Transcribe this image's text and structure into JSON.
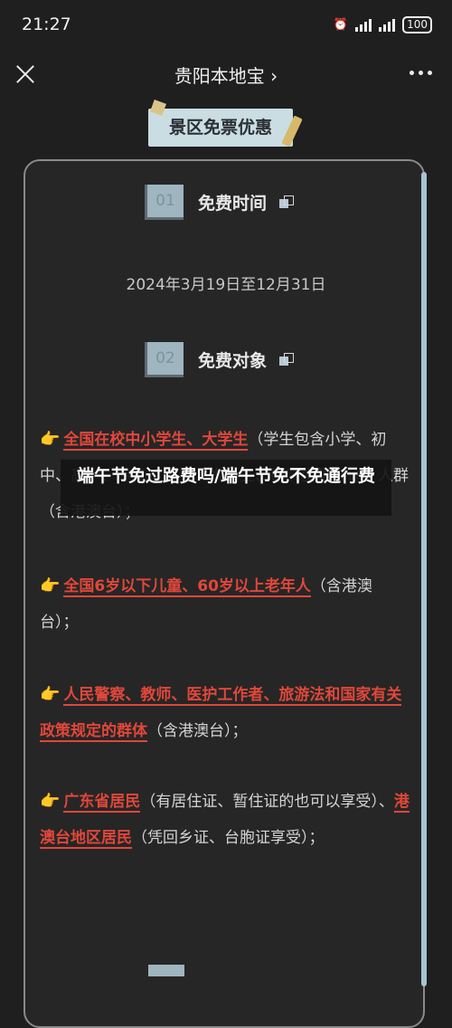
{
  "status": {
    "time": "21:27",
    "battery": "100"
  },
  "nav": {
    "title": "贵阳本地宝 ›"
  },
  "banner": {
    "label": "景区免票优惠"
  },
  "sections": [
    {
      "num": "01",
      "title": "免费时间"
    },
    {
      "num": "02",
      "title": "免费对象"
    }
  ],
  "free_time": "2024年3月19日至12月31日",
  "items": [
    {
      "highlight": "全国在校中小学生、大学生",
      "rest": "（学生包含小学、初中、高中、中专、大专、本科生、研究生等群体）人群（含港澳台）；"
    },
    {
      "highlight": "全国6岁以下儿童、60岁以上老年人",
      "rest": "（含港澳台）；"
    },
    {
      "highlight": "人民警察、教师、医护工作者、旅游法和国家有关政策规定的群体",
      "rest": "（含港澳台）；"
    },
    {
      "highlight": "广东省居民",
      "rest": "（有居住证、暂住证的也可以享受）、",
      "highlight2": "港澳台地区居民",
      "rest2": "（凭回乡证、台胞证享受）；"
    }
  ],
  "overlay_title": "端午节免过路费吗/端午节免不免通行费",
  "colors": {
    "background": "#1f1f1f",
    "highlight": "#e0473a",
    "accent": "#c9dde3"
  }
}
